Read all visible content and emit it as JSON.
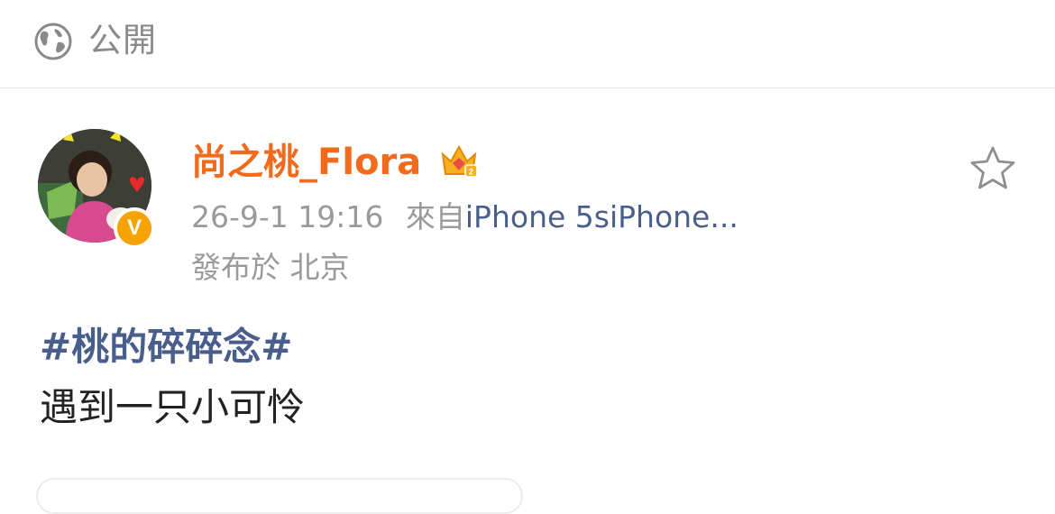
{
  "header": {
    "visibility_label": "公開",
    "visibility_icon": "globe-icon"
  },
  "post": {
    "author": {
      "name": "尚之桃_Flora",
      "badge_icon": "crown-icon",
      "verified_icon": "verified-v-icon",
      "verified_letter": "V"
    },
    "timestamp": "26-9-1 19:16",
    "source_prefix": "來自",
    "source": "iPhone 5siPhone...",
    "location": "發布於 北京",
    "hashtag": "#桃的碎碎念#",
    "text": "遇到一只小可怜",
    "favorite_icon": "star-outline-icon"
  },
  "colors": {
    "username": "#f26a1b",
    "link": "#4a5e8c",
    "secondary_text": "#9a9a9a",
    "verified_badge": "#f6a200"
  }
}
